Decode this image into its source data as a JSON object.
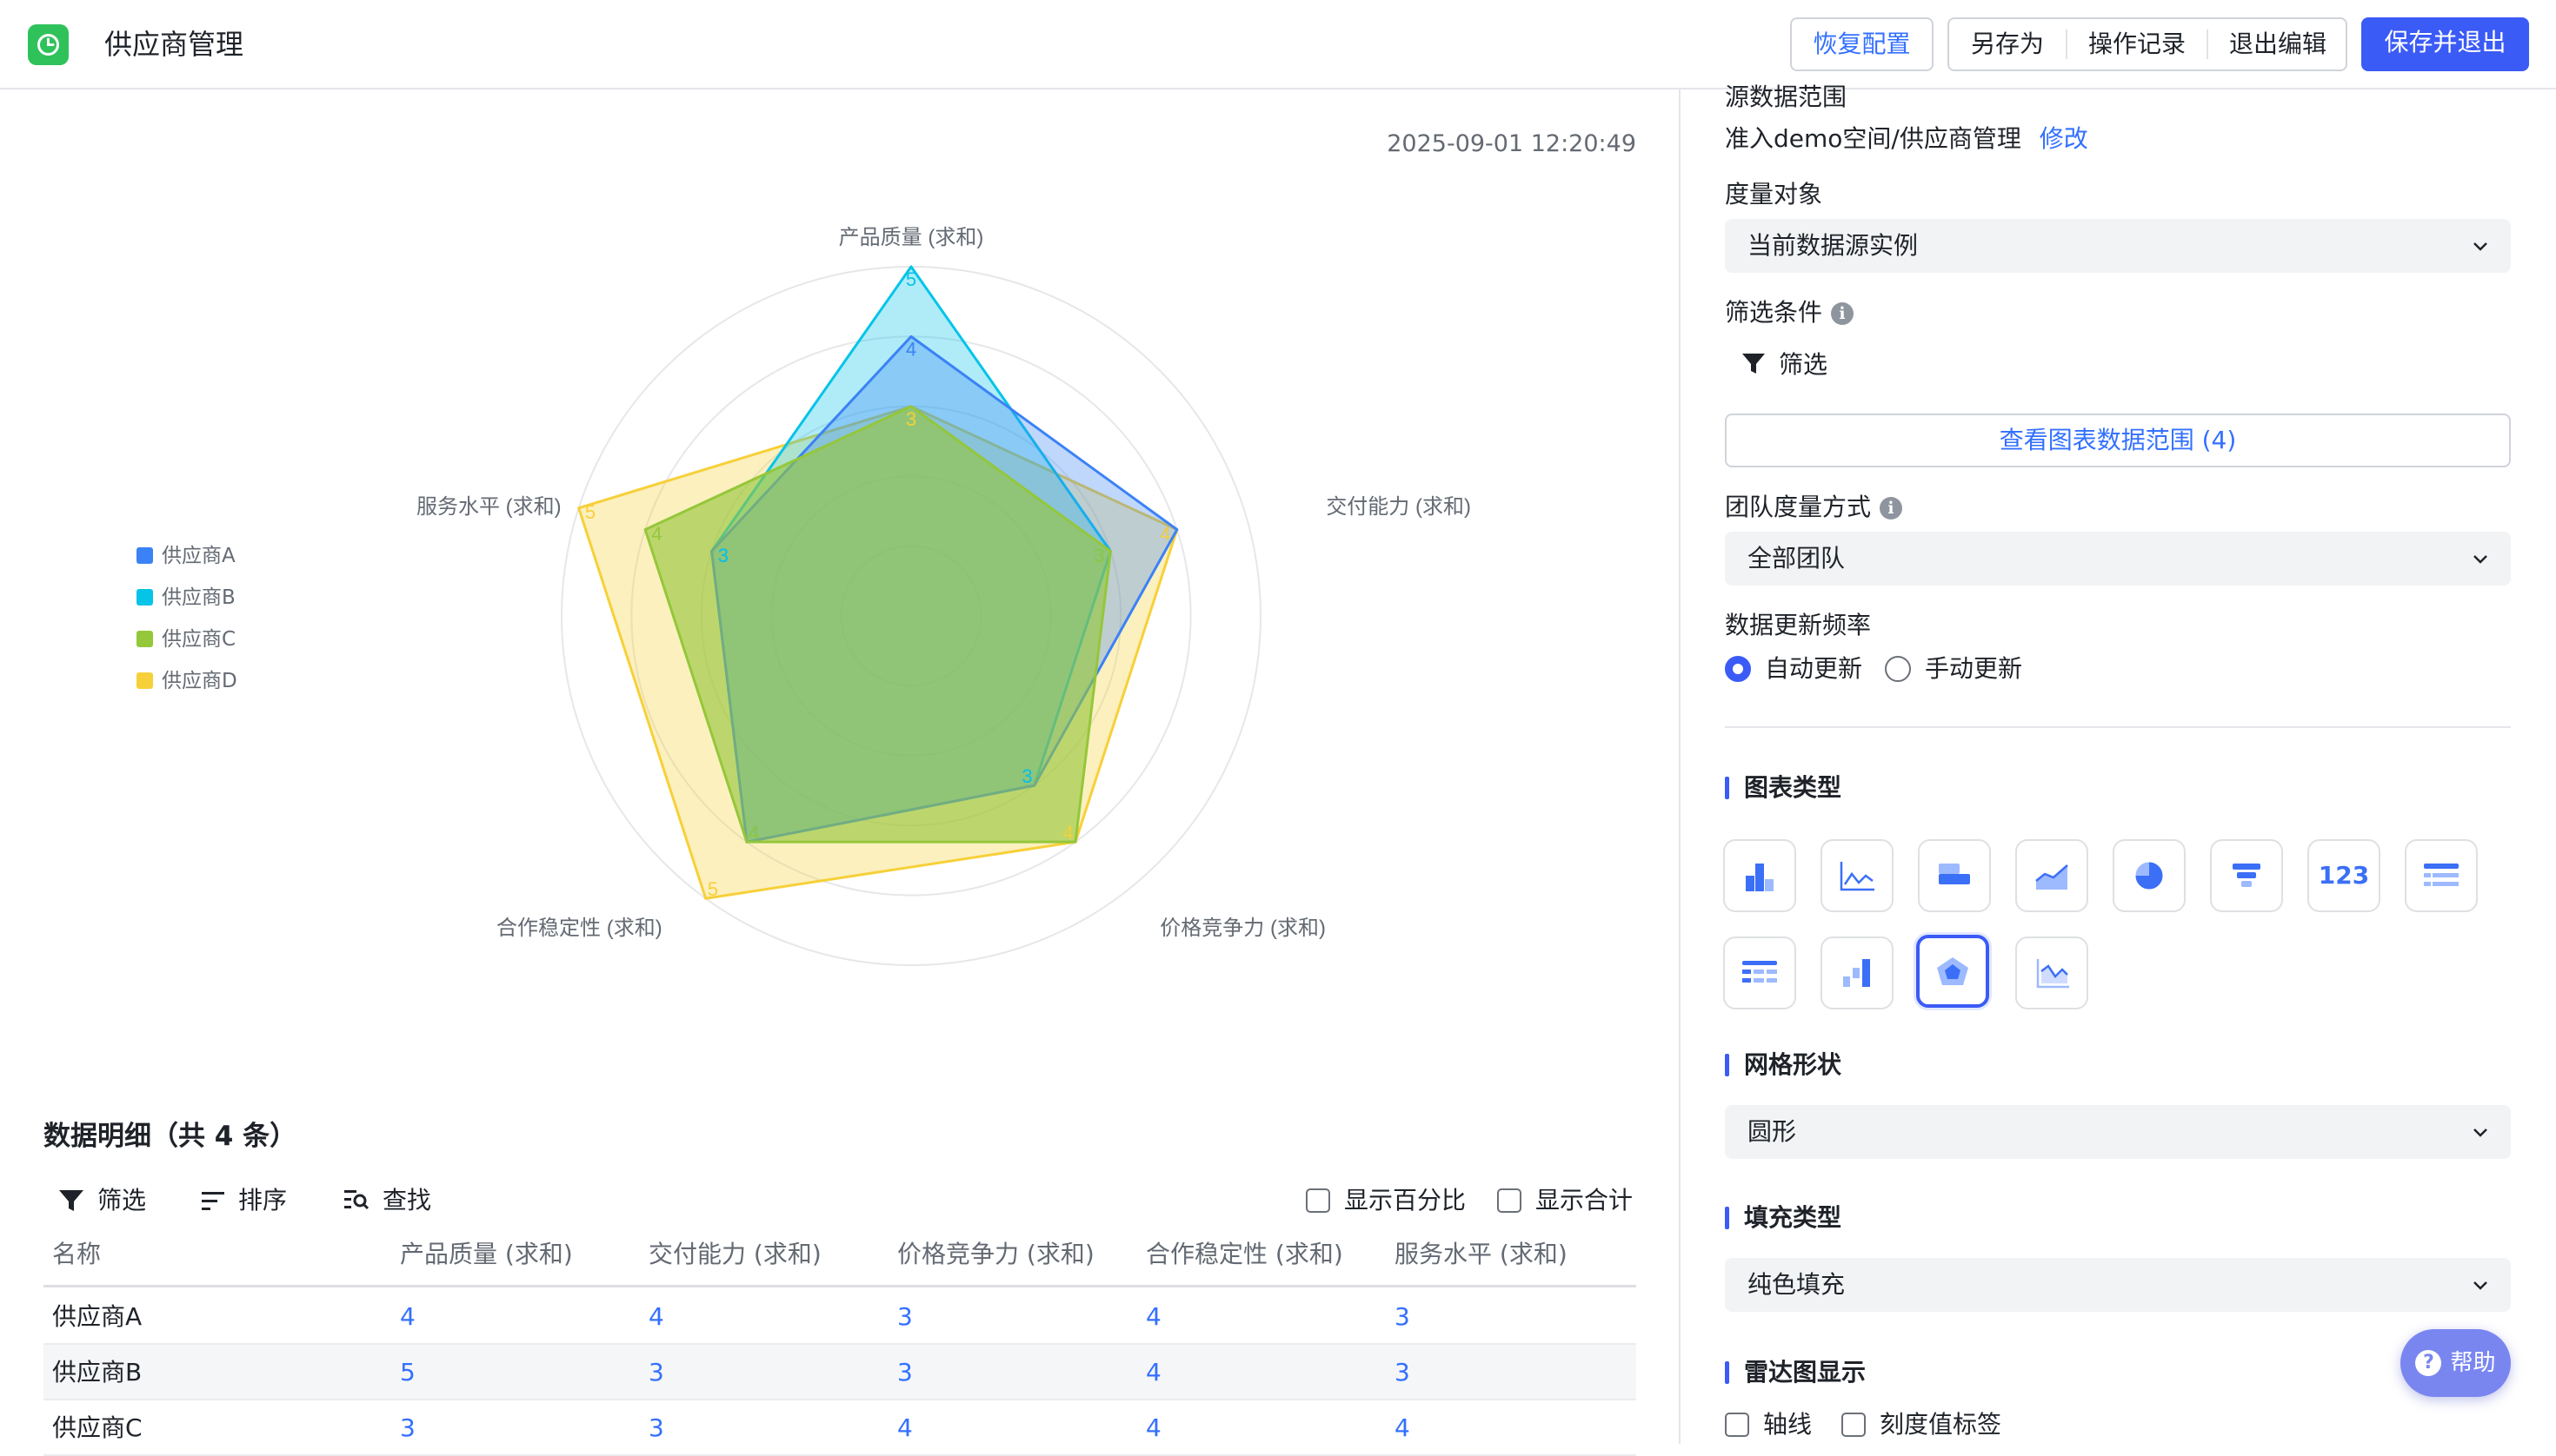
{
  "header": {
    "app_title": "供应商管理",
    "restore_label": "恢复配置",
    "save_as_label": "另存为",
    "history_label": "操作记录",
    "exit_edit_label": "退出编辑",
    "save_exit_label": "保存并退出"
  },
  "chart_panel": {
    "timestamp": "2025-09-01 12:20:49"
  },
  "chart_data": {
    "type": "radar",
    "grid_shape": "circle",
    "fill": "solid",
    "max": 5,
    "axes": [
      "产品质量 (求和)",
      "交付能力 (求和)",
      "价格竞争力 (求和)",
      "合作稳定性 (求和)",
      "服务水平 (求和)"
    ],
    "series": [
      {
        "name": "供应商A",
        "color": "#3b82f6",
        "values": [
          4,
          4,
          3,
          4,
          3
        ]
      },
      {
        "name": "供应商B",
        "color": "#06c4e8",
        "values": [
          5,
          3,
          3,
          4,
          3
        ]
      },
      {
        "name": "供应商C",
        "color": "#94c73a",
        "values": [
          3,
          3,
          4,
          4,
          4
        ]
      },
      {
        "name": "供应商D",
        "color": "#f7d039",
        "values": [
          3,
          4,
          4,
          5,
          5
        ]
      }
    ],
    "legend_position": "left"
  },
  "detail": {
    "title": "数据明细（共 4 条）",
    "filter_label": "筛选",
    "sort_label": "排序",
    "find_label": "查找",
    "show_percent_label": "显示百分比",
    "show_total_label": "显示合计",
    "columns": [
      "名称",
      "产品质量 (求和)",
      "交付能力 (求和)",
      "价格竞争力 (求和)",
      "合作稳定性 (求和)",
      "服务水平 (求和)"
    ],
    "rows": [
      {
        "name": "供应商A",
        "values": [
          "4",
          "4",
          "3",
          "4",
          "3"
        ]
      },
      {
        "name": "供应商B",
        "values": [
          "5",
          "3",
          "3",
          "4",
          "3"
        ]
      },
      {
        "name": "供应商C",
        "values": [
          "3",
          "3",
          "4",
          "4",
          "4"
        ]
      }
    ]
  },
  "settings": {
    "source_range_label": "源数据范围",
    "source_path": "准入demo空间/供应商管理",
    "modify_label": "修改",
    "measure_object_label": "度量对象",
    "measure_object_value": "当前数据源实例",
    "filter_condition_label": "筛选条件",
    "filter_label": "筛选",
    "view_range_label": "查看图表数据范围 (4)",
    "team_measure_label": "团队度量方式",
    "team_measure_value": "全部团队",
    "update_freq_label": "数据更新频率",
    "auto_update_label": "自动更新",
    "manual_update_label": "手动更新",
    "chart_type_title": "图表类型",
    "number_card_label": "123",
    "grid_shape_title": "网格形状",
    "grid_shape_value": "圆形",
    "fill_type_title": "填充类型",
    "fill_type_value": "纯色填充",
    "radar_display_title": "雷达图显示",
    "axis_line_label": "轴线",
    "tick_label_label": "刻度值标签",
    "help_label": "帮助"
  },
  "colors": {
    "primary": "#3b5bf6",
    "link": "#3370ff",
    "logo": "#2fc25b"
  }
}
